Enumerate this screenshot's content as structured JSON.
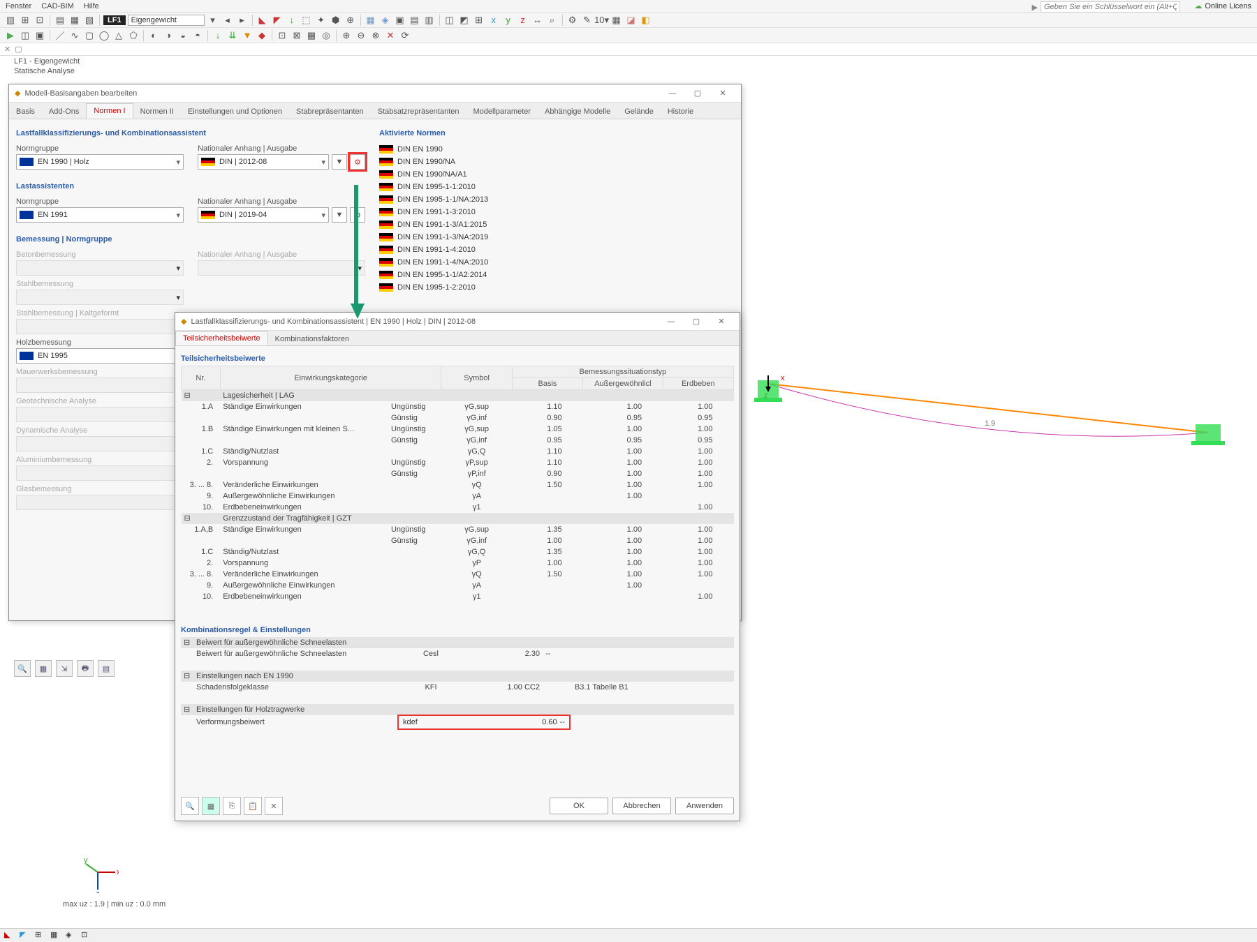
{
  "menubar": [
    "Fenster",
    "CAD-BIM",
    "Hilfe"
  ],
  "keyword_placeholder": "Geben Sie ein Schlüsselwort ein (Alt+Q)",
  "online_license": "Online Licens",
  "lf_badge": "LF1",
  "lf_sel": "Eigengewicht",
  "doc_title": "LF1 - Eigengewicht",
  "doc_sub": "Statische Analyse",
  "dialog1": {
    "title": "Modell-Basisangaben bearbeiten",
    "tabs": [
      "Basis",
      "Add-Ons",
      "Normen I",
      "Normen II",
      "Einstellungen und Optionen",
      "Stabrepräsentanten",
      "Stabsatzrepräsentanten",
      "Modellparameter",
      "Abhängige Modelle",
      "Gelände",
      "Historie"
    ],
    "active_tab": 2,
    "sect_klass": "Lastfallklassifizierungs- und Kombinationsassistent",
    "normgruppe_lbl": "Normgruppe",
    "normgruppe_val": "EN 1990 | Holz",
    "anhang_lbl": "Nationaler Anhang | Ausgabe",
    "anhang_val": "DIN | 2012-08",
    "sect_last": "Lastassistenten",
    "last_ng_val": "EN 1991",
    "last_anhang_val": "DIN | 2019-04",
    "sect_bem": "Bemessung | Normgruppe",
    "bem_rows": [
      "Betonbemessung",
      "Stahlbemessung",
      "Stahlbemessung | Kaltgeformt",
      "Holzbemessung",
      "Mauerwerksbemessung",
      "Geotechnische Analyse",
      "Dynamische Analyse",
      "Aluminiumbemessung",
      "Glasbemessung"
    ],
    "holz_val": "EN 1995",
    "sect_norm": "Aktivierte Normen",
    "norms": [
      "DIN EN 1990",
      "DIN EN 1990/NA",
      "DIN EN 1990/NA/A1",
      "DIN EN 1995-1-1:2010",
      "DIN EN 1995-1-1/NA:2013",
      "DIN EN 1991-1-3:2010",
      "DIN EN 1991-1-3/A1:2015",
      "DIN EN 1991-1-3/NA:2019",
      "DIN EN 1991-1-4:2010",
      "DIN EN 1991-1-4/NA:2010",
      "DIN EN 1995-1-1/A2:2014",
      "DIN EN 1995-1-2:2010"
    ]
  },
  "dialog2": {
    "title": "Lastfallklassifizierungs- und Kombinationsassistent | EN 1990 | Holz | DIN | 2012-08",
    "tabs": [
      "Teilsicherheitsbeiwerte",
      "Kombinationsfaktoren"
    ],
    "sect": "Teilsicherheitsbeiwerte",
    "col_hdr": [
      "Nr.",
      "Einwirkungskategorie",
      "",
      "Symbol",
      "Basis",
      "Außergewöhnlicl",
      "Erdbeben"
    ],
    "col_span_hdr": "Bemessungssituationstyp",
    "grp1": "Lagesicherheit | LAG",
    "rows1": [
      {
        "nr": "1.A",
        "kat": "Ständige Einwirkungen",
        "fav": "Ungünstig",
        "sym": "γG,sup",
        "b": "1.10",
        "a": "1.00",
        "e": "1.00"
      },
      {
        "nr": "",
        "kat": "",
        "fav": "Günstig",
        "sym": "γG,inf",
        "b": "0.90",
        "a": "0.95",
        "e": "0.95"
      },
      {
        "nr": "1.B",
        "kat": "Ständige Einwirkungen mit kleinen S...",
        "fav": "Ungünstig",
        "sym": "γG,sup",
        "b": "1.05",
        "a": "1.00",
        "e": "1.00"
      },
      {
        "nr": "",
        "kat": "",
        "fav": "Günstig",
        "sym": "γG,inf",
        "b": "0.95",
        "a": "0.95",
        "e": "0.95"
      },
      {
        "nr": "1.C",
        "kat": "Ständig/Nutzlast",
        "fav": "",
        "sym": "γG,Q",
        "b": "1.10",
        "a": "1.00",
        "e": "1.00"
      },
      {
        "nr": "2.",
        "kat": "Vorspannung",
        "fav": "Ungünstig",
        "sym": "γP,sup",
        "b": "1.10",
        "a": "1.00",
        "e": "1.00"
      },
      {
        "nr": "",
        "kat": "",
        "fav": "Günstig",
        "sym": "γP,inf",
        "b": "0.90",
        "a": "1.00",
        "e": "1.00"
      },
      {
        "nr": "3. ... 8.",
        "kat": "Veränderliche Einwirkungen",
        "fav": "",
        "sym": "γQ",
        "b": "1.50",
        "a": "1.00",
        "e": "1.00"
      },
      {
        "nr": "9.",
        "kat": "Außergewöhnliche Einwirkungen",
        "fav": "",
        "sym": "γA",
        "b": "",
        "a": "1.00",
        "e": ""
      },
      {
        "nr": "10.",
        "kat": "Erdbebeneinwirkungen",
        "fav": "",
        "sym": "γ1",
        "b": "",
        "a": "",
        "e": "1.00"
      }
    ],
    "grp2": "Grenzzustand der Tragfähigkeit | GZT",
    "rows2": [
      {
        "nr": "1.A,B",
        "kat": "Ständige Einwirkungen",
        "fav": "Ungünstig",
        "sym": "γG,sup",
        "b": "1.35",
        "a": "1.00",
        "e": "1.00"
      },
      {
        "nr": "",
        "kat": "",
        "fav": "Günstig",
        "sym": "γG,inf",
        "b": "1.00",
        "a": "1.00",
        "e": "1.00"
      },
      {
        "nr": "1.C",
        "kat": "Ständig/Nutzlast",
        "fav": "",
        "sym": "γG,Q",
        "b": "1.35",
        "a": "1.00",
        "e": "1.00"
      },
      {
        "nr": "2.",
        "kat": "Vorspannung",
        "fav": "",
        "sym": "γP",
        "b": "1.00",
        "a": "1.00",
        "e": "1.00"
      },
      {
        "nr": "3. ... 8.",
        "kat": "Veränderliche Einwirkungen",
        "fav": "",
        "sym": "γQ",
        "b": "1.50",
        "a": "1.00",
        "e": "1.00"
      },
      {
        "nr": "9.",
        "kat": "Außergewöhnliche Einwirkungen",
        "fav": "",
        "sym": "γA",
        "b": "",
        "a": "1.00",
        "e": ""
      },
      {
        "nr": "10.",
        "kat": "Erdbebeneinwirkungen",
        "fav": "",
        "sym": "γ1",
        "b": "",
        "a": "",
        "e": "1.00"
      }
    ],
    "sect_komb": "Kombinationsregel & Einstellungen",
    "grp3": "Beiwert für außergewöhnliche Schneelasten",
    "row3": {
      "kat": "Beiwert für außergewöhnliche Schneelasten",
      "sym": "Cesl",
      "val": "2.30",
      "unit": "--"
    },
    "grp4": "Einstellungen nach EN 1990",
    "row4": {
      "kat": "Schadensfolgeklasse",
      "sym": "KFI",
      "val": "1.00",
      "extra": "CC2",
      "ref": "B3.1 Tabelle B1"
    },
    "grp5": "Einstellungen für Holztragwerke",
    "row5": {
      "kat": "Verformungsbeiwert",
      "sym": "kdef",
      "val": "0.60",
      "unit": "--"
    },
    "btn_ok": "OK",
    "btn_cancel": "Abbrechen",
    "btn_apply": "Anwenden"
  },
  "beam_label": "1.9",
  "status_text": "max uz : 1.9 | min uz : 0.0 mm"
}
